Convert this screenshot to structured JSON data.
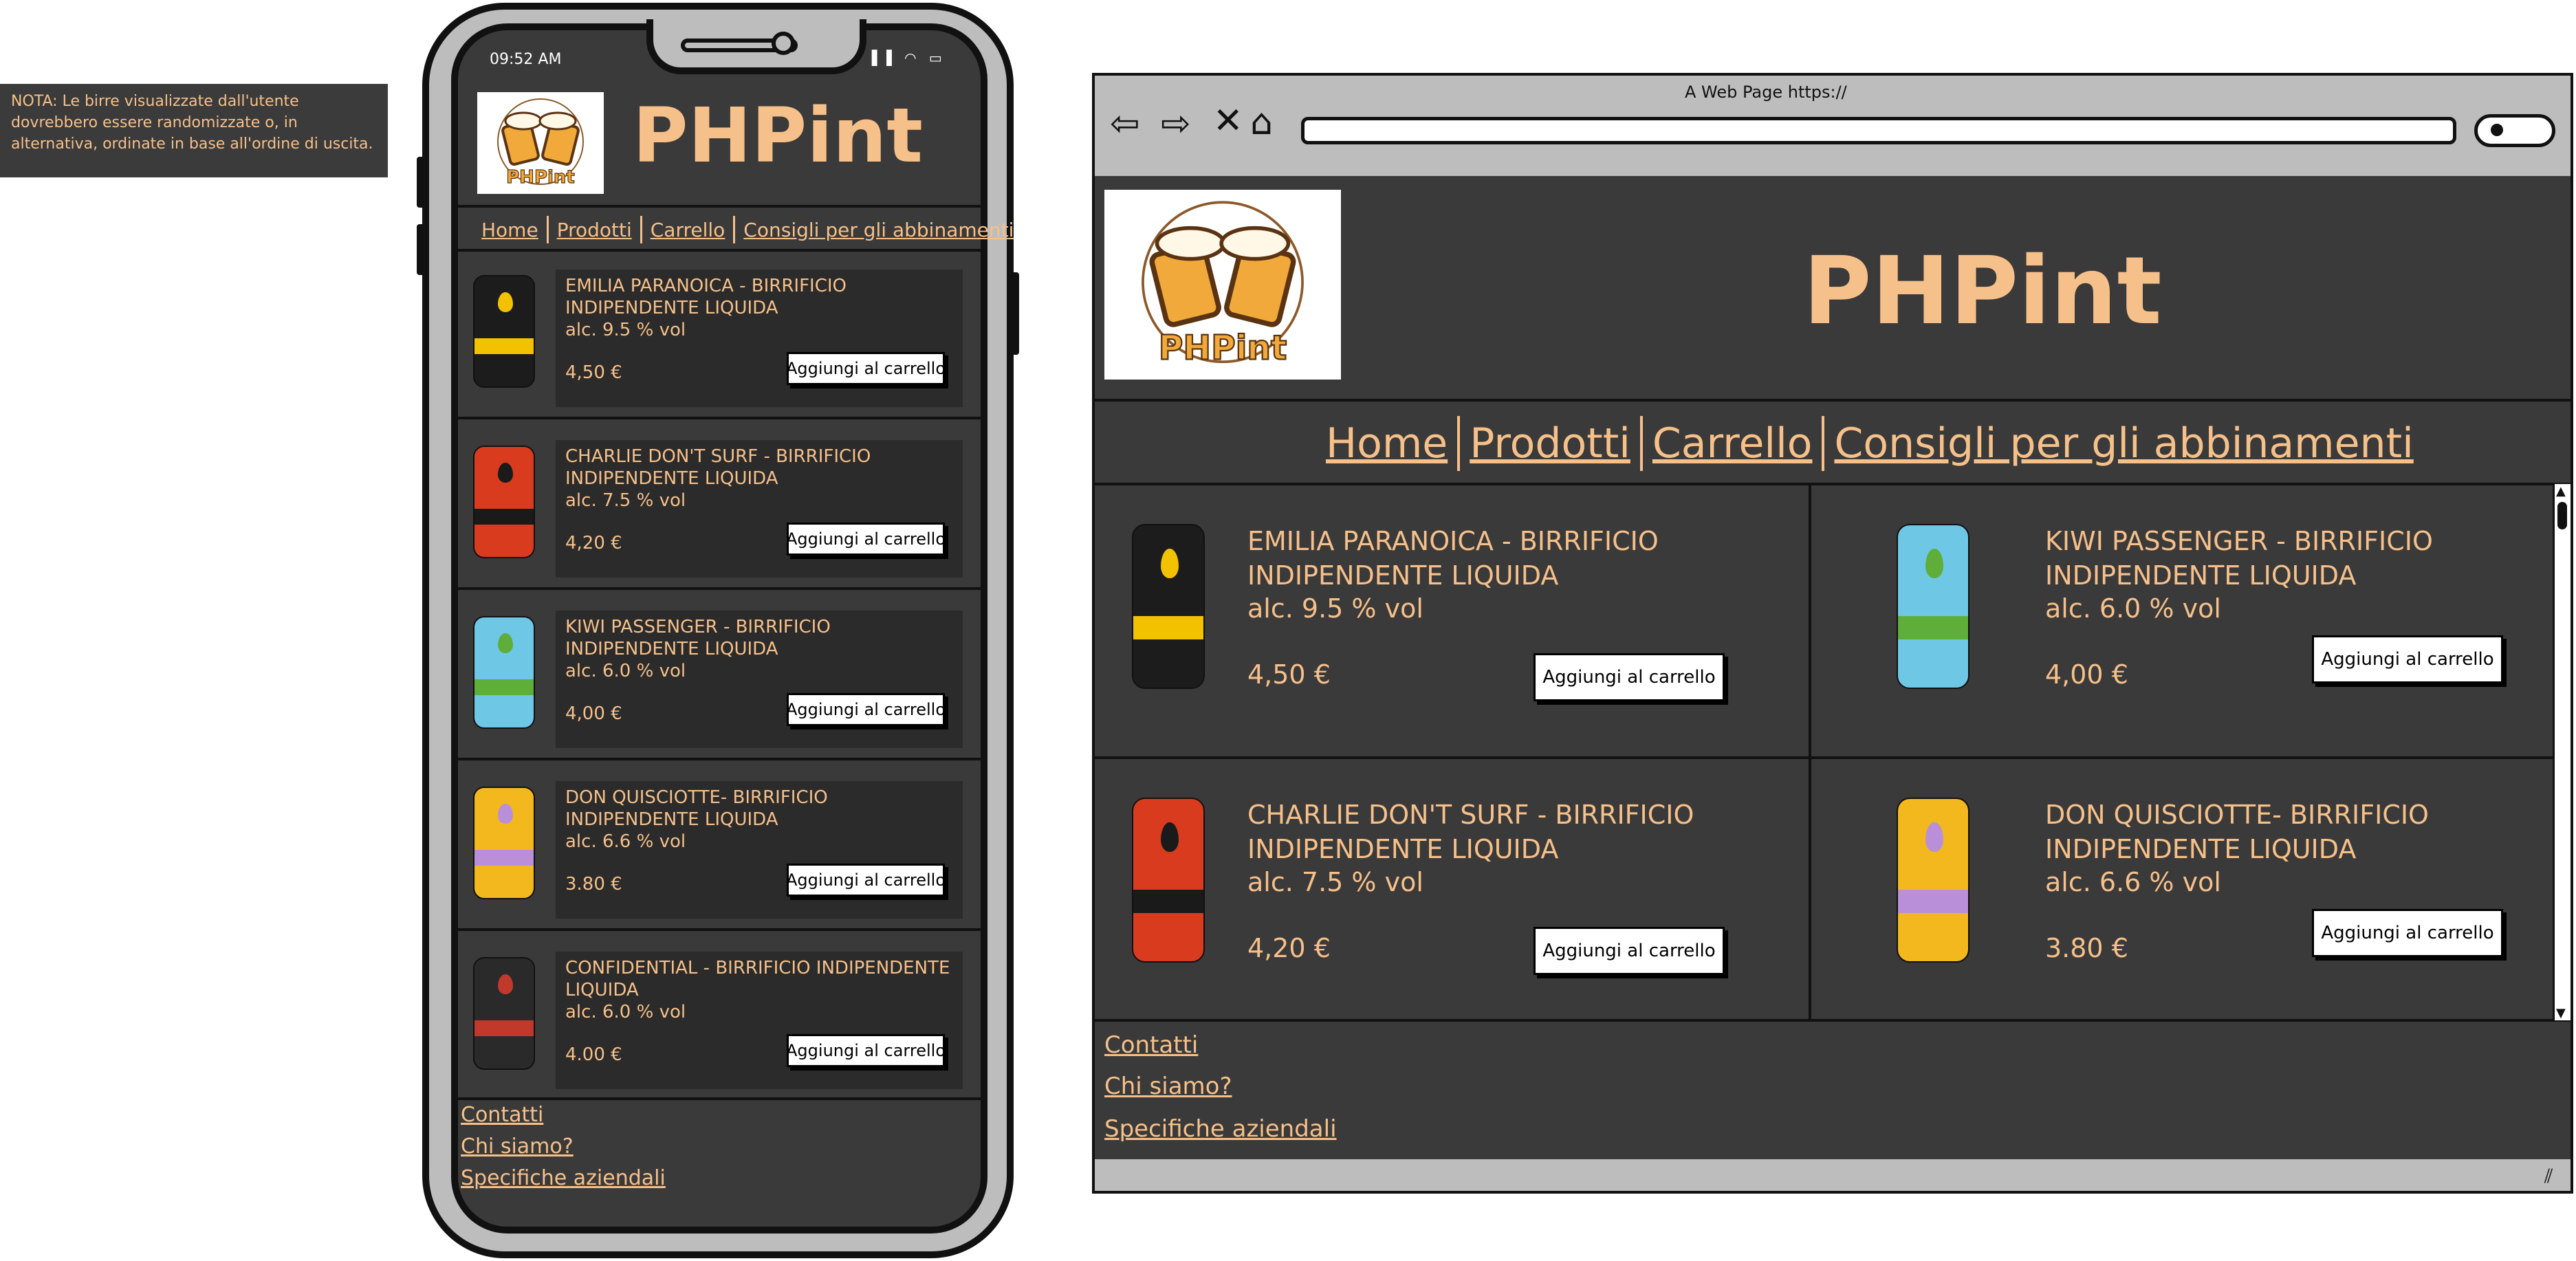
{
  "note": "NOTA: Le birre visualizzate dall'utente dovrebbero essere randomizzate o, in alternativa, ordinate in base all'ordine di uscita.",
  "phone": {
    "time": "09:52 AM",
    "status_icons": "▐▐ ◠ ▭"
  },
  "brand": {
    "title": "PHPint",
    "logo_text": "PHPint"
  },
  "nav": {
    "items": [
      "Home",
      "Prodotti",
      "Carrello",
      "Consigli per gli abbinamenti"
    ]
  },
  "products_mobile": [
    {
      "name": "EMILIA PARANOICA - BIRRIFICIO INDIPENDENTE LIQUIDA",
      "alc": "alc. 9.5 % vol",
      "price": "4,50 €",
      "can_color": "#1c1c1c",
      "accent": "#f2c200"
    },
    {
      "name": "CHARLIE DON'T SURF - BIRRIFICIO INDIPENDENTE LIQUIDA",
      "alc": "alc. 7.5 % vol",
      "price": "4,20 €",
      "can_color": "#d83b1e",
      "accent": "#1a1a1a"
    },
    {
      "name": "KIWI PASSENGER - BIRRIFICIO INDIPENDENTE LIQUIDA",
      "alc": "alc. 6.0 % vol",
      "price": "4,00 €",
      "can_color": "#6fc7e6",
      "accent": "#5fae3a"
    },
    {
      "name": "DON QUISCIOTTE- BIRRIFICIO INDIPENDENTE LIQUIDA",
      "alc": "alc. 6.6 % vol",
      "price": "3.80 €",
      "can_color": "#f2b81e",
      "accent": "#b98fd9"
    },
    {
      "name": "CONFIDENTIAL -  BIRRIFICIO INDIPENDENTE LIQUIDA",
      "alc": "alc. 6.0 % vol",
      "price": "4.00 €",
      "can_color": "#2a2a2a",
      "accent": "#c0392b"
    }
  ],
  "products_desktop": [
    {
      "name": "EMILIA PARANOICA - BIRRIFICIO INDIPENDENTE LIQUIDA",
      "alc": "alc. 9.5 % vol",
      "price": "4,50 €",
      "can_color": "#1c1c1c",
      "accent": "#f2c200"
    },
    {
      "name": "KIWI PASSENGER - BIRRIFICIO INDIPENDENTE LIQUIDA",
      "alc": "alc. 6.0 % vol",
      "price": "4,00 €",
      "can_color": "#6fc7e6",
      "accent": "#5fae3a"
    },
    {
      "name": "CHARLIE DON'T SURF - BIRRIFICIO INDIPENDENTE LIQUIDA",
      "alc": "alc. 7.5 % vol",
      "price": "4,20 €",
      "can_color": "#d83b1e",
      "accent": "#1a1a1a"
    },
    {
      "name": "DON QUISCIOTTE- BIRRIFICIO INDIPENDENTE LIQUIDA",
      "alc": "alc. 6.6 % vol",
      "price": "3.80 €",
      "can_color": "#f2b81e",
      "accent": "#b98fd9"
    }
  ],
  "add_to_cart": "Aggiungi al carrello",
  "footer": {
    "links": [
      "Contatti",
      "Chi siamo?",
      "Specifiche aziendali"
    ]
  },
  "browser": {
    "title": "A Web Page https://"
  },
  "colors": {
    "accent": "#f6c08a",
    "background": "#3a3a3a",
    "card": "#2b2b2b"
  }
}
